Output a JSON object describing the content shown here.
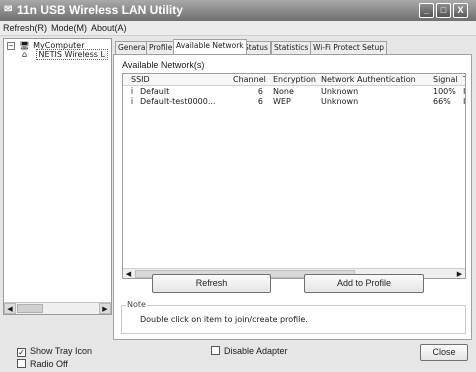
{
  "window": {
    "title": "11n USB Wireless LAN Utility",
    "controls": [
      "_",
      "□",
      "X"
    ]
  },
  "menu": [
    {
      "label": "Refresh(R)"
    },
    {
      "label": "Mode(M)"
    },
    {
      "label": "About(A)"
    }
  ],
  "tree": {
    "root": "MyComputer",
    "child": "NETIS Wireless L"
  },
  "tabs": [
    {
      "label": "General"
    },
    {
      "label": "Profile"
    },
    {
      "label": "Available Network",
      "active": true
    },
    {
      "label": "Status"
    },
    {
      "label": "Statistics"
    },
    {
      "label": "Wi-Fi Protect Setup"
    }
  ],
  "available": {
    "section_label": "Available Network(s)",
    "columns": [
      "SSID",
      "Channel",
      "Encryption",
      "Network Authentication",
      "Signal",
      "T"
    ],
    "rows": [
      {
        "ssid": "Default",
        "channel": "6",
        "encryption": "None",
        "auth": "Unknown",
        "signal": "100%",
        "extra": "Ir"
      },
      {
        "ssid": "Default-test0000...",
        "channel": "6",
        "encryption": "WEP",
        "auth": "Unknown",
        "signal": "66%",
        "extra": "Ir"
      }
    ]
  },
  "buttons": {
    "refresh": "Refresh",
    "add_to_profile": "Add to Profile",
    "close": "Close"
  },
  "note": {
    "title": "Note",
    "text": "Double click on item to join/create profile."
  },
  "options": {
    "show_tray_icon": {
      "label": "Show Tray Icon",
      "checked": true
    },
    "radio_off": {
      "label": "Radio Off",
      "checked": false
    },
    "disable_adapter": {
      "label": "Disable Adapter",
      "checked": false
    }
  }
}
